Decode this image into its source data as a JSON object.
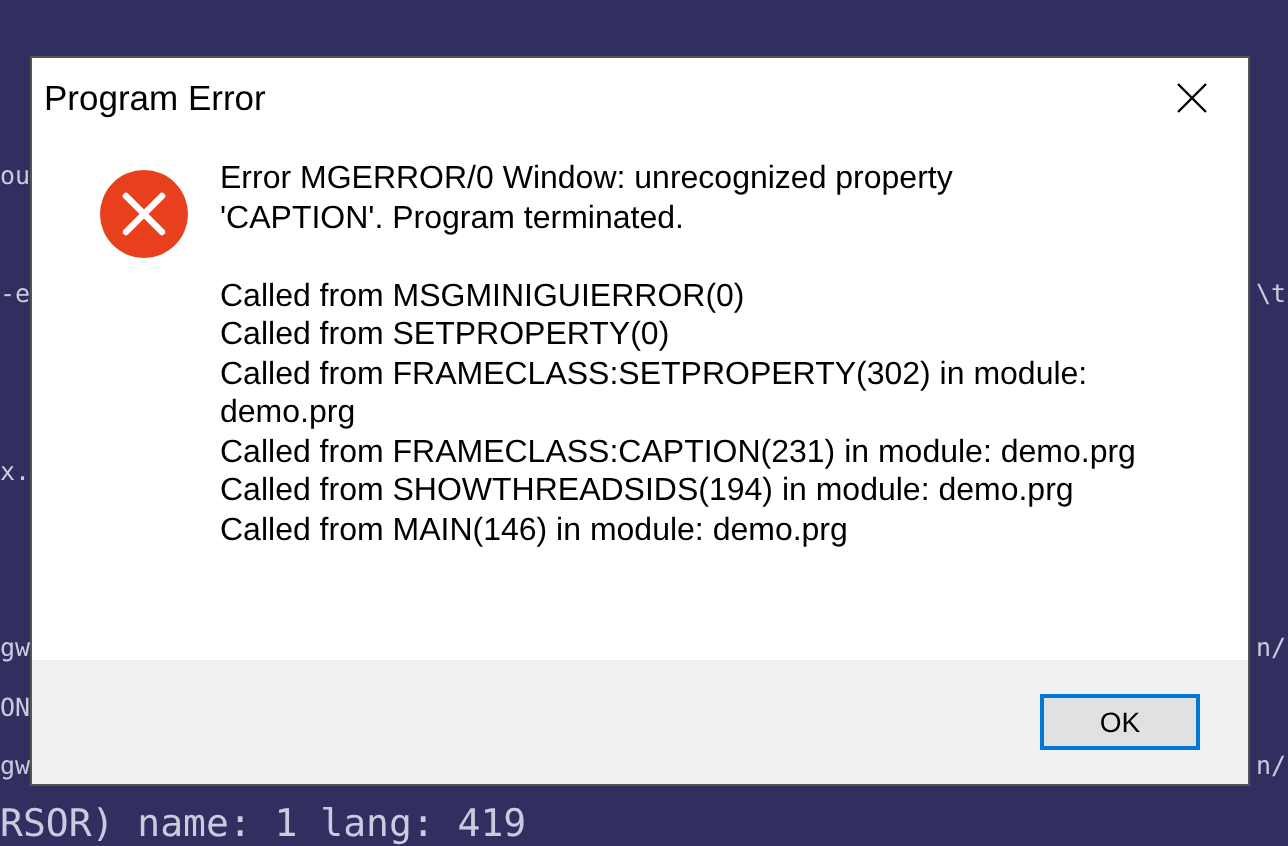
{
  "terminal": {
    "lines": [
      {
        "kind": "text",
        "left": "ou"
      },
      {
        "kind": "blank"
      },
      {
        "kind": "text",
        "left": "-e",
        "right": "\\t"
      },
      {
        "kind": "blank"
      },
      {
        "kind": "blank"
      },
      {
        "kind": "text",
        "left": "x."
      },
      {
        "kind": "blank"
      },
      {
        "kind": "blank"
      },
      {
        "kind": "text",
        "left": "gw",
        "right": "n/"
      },
      {
        "kind": "text",
        "left": "ON"
      },
      {
        "kind": "text",
        "left": "gw",
        "right": "n/"
      },
      {
        "kind": "text",
        "left": "RSOR) name: 1 lang: 419"
      }
    ]
  },
  "dialog": {
    "title": "Program Error",
    "message": "Error MGERROR/0 Window: unrecognized property 'CAPTION'. Program terminated.",
    "trace": [
      "Called from MSGMINIGUIERROR(0)",
      "Called from SETPROPERTY(0)",
      "Called from FRAMECLASS:SETPROPERTY(302) in module: demo.prg",
      "Called from FRAMECLASS:CAPTION(231) in module: demo.prg",
      "Called from SHOWTHREADSIDS(194) in module: demo.prg",
      "Called from MAIN(146) in module: demo.prg"
    ],
    "buttons": [
      {
        "label": "OK",
        "default": true
      }
    ]
  }
}
